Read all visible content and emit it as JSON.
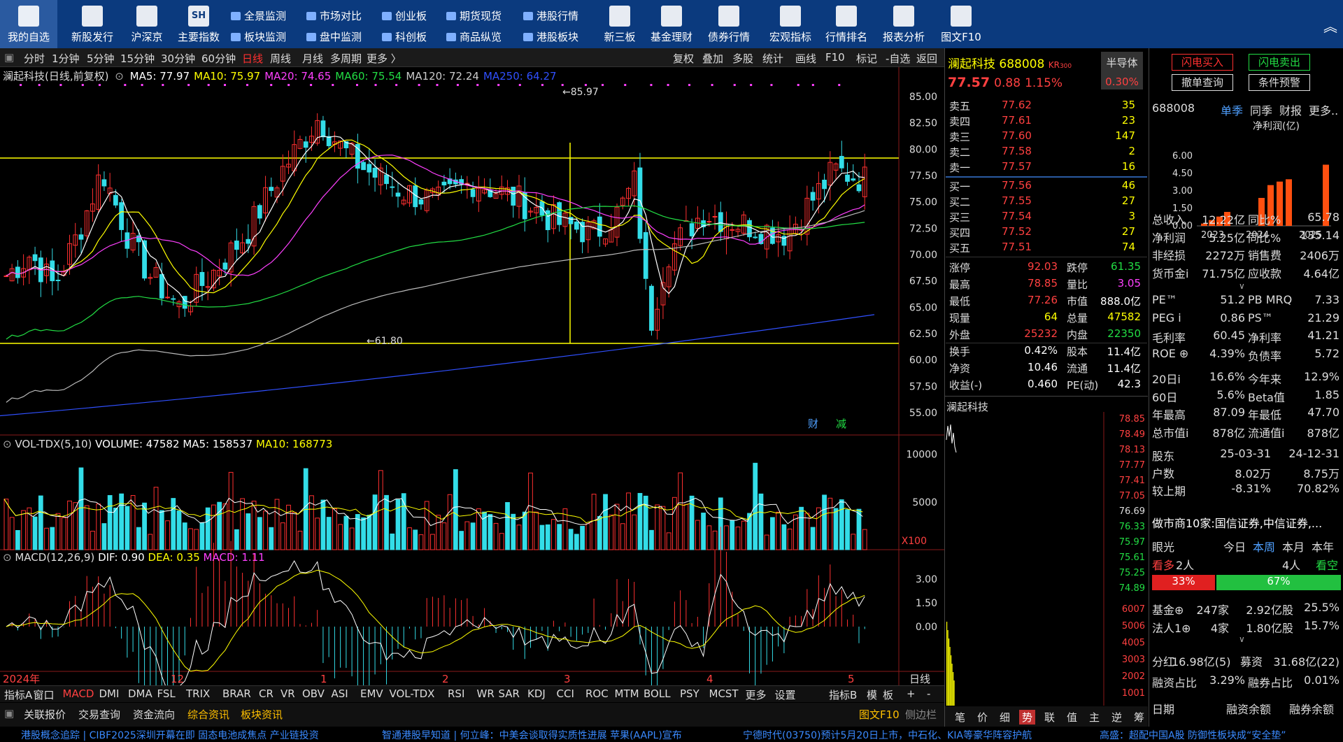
{
  "toolbar": {
    "big": [
      {
        "label": "我的自选",
        "icon": "star-list-icon"
      },
      {
        "label": "新股发行",
        "icon": "document-icon"
      },
      {
        "label": "沪深京",
        "icon": "chart-icon"
      },
      {
        "label": "主要指数",
        "icon": "sh-index-icon"
      },
      {
        "label": "新三板",
        "icon": "money-bag-icon"
      },
      {
        "label": "基金理财",
        "icon": "yen-icon"
      },
      {
        "label": "债券行情",
        "icon": "bond-list-icon"
      },
      {
        "label": "宏观指标",
        "icon": "globe-icon"
      },
      {
        "label": "行情排名",
        "icon": "camera-icon"
      },
      {
        "label": "报表分析",
        "icon": "report-icon"
      },
      {
        "label": "图文F10",
        "icon": "person-icon"
      }
    ],
    "small": [
      "全景监测",
      "市场对比",
      "创业板",
      "期货现货",
      "港股行情",
      "板块监测",
      "盘中监测",
      "科创板",
      "商品纵览",
      "港股板块"
    ],
    "sh_text": "SH"
  },
  "periods": [
    "分时",
    "1分钟",
    "5分钟",
    "15分钟",
    "30分钟",
    "60分钟",
    "日线",
    "周线",
    "月线",
    "多周期",
    "更多 〉"
  ],
  "tools": [
    "复权",
    "叠加",
    "多股",
    "统计",
    "画线",
    "F10",
    "标记",
    "-自选",
    "返回"
  ],
  "chart": {
    "title": "澜起科技(日线,前复权)",
    "ma": [
      {
        "t": "MA5: 77.97",
        "c": "#ffffff"
      },
      {
        "t": "MA10: 75.97",
        "c": "#ffff00"
      },
      {
        "t": "MA20: 74.65",
        "c": "#ff40ff"
      },
      {
        "t": "MA60: 75.54",
        "c": "#22dd44"
      },
      {
        "t": "MA120: 72.24",
        "c": "#cccccc"
      },
      {
        "t": "MA250: 64.27",
        "c": "#3050ff"
      }
    ],
    "high_label": "85.97",
    "low_label": "61.80",
    "y_ticks": [
      "85.00",
      "82.50",
      "80.00",
      "77.50",
      "75.00",
      "72.50",
      "70.00",
      "67.50",
      "65.00",
      "62.50",
      "60.00",
      "57.50",
      "55.00"
    ],
    "badge1": "财",
    "badge2": "减"
  },
  "volume": {
    "title": "VOL-TDX(5,10)",
    "v": "VOLUME: 47582",
    "ma5": "MA5: 158537",
    "ma10": "MA10: 168773",
    "ticks": [
      "10000",
      "5000"
    ],
    "unit": "X100"
  },
  "macd": {
    "title": "MACD(12,26,9)",
    "dif": "DIF: 0.90",
    "dea": "DEA: 0.35",
    "macd": "MACD: 1.11",
    "ticks": [
      "3.00",
      "1.50",
      "0.00"
    ]
  },
  "xaxis": [
    "2024年",
    "12",
    "1",
    "2",
    "3",
    "4",
    "5"
  ],
  "xaxis_right": "日线",
  "indicator_tabs": [
    "指标A",
    "窗口",
    "MACD",
    "DMI",
    "DMA",
    "FSL",
    "TRIX",
    "BRAR",
    "CR",
    "VR",
    "OBV",
    "ASI",
    "EMV",
    "VOL-TDX",
    "RSI",
    "WR",
    "SAR",
    "KDJ",
    "CCI",
    "ROC",
    "MTM",
    "BOLL",
    "PSY",
    "MCST",
    "更多",
    "设置"
  ],
  "indicator_right": [
    "指标B",
    "模",
    "板",
    "+",
    "-"
  ],
  "bottom_tabs": [
    "关联报价",
    "交易查询",
    "资金流向",
    "综合资讯",
    "板块资讯"
  ],
  "bottom_right": [
    "图文F10",
    "侧边栏"
  ],
  "quote": {
    "name": "澜起科技",
    "code": "688008",
    "kr": "KR",
    "kr_sub": "300",
    "price": "77.57",
    "chg": "0.88",
    "pct": "1.15%",
    "half": "半导体",
    "half_pct": "0.30%"
  },
  "sells": [
    [
      "卖五",
      "77.62",
      "35"
    ],
    [
      "卖四",
      "77.61",
      "23"
    ],
    [
      "卖三",
      "77.60",
      "147"
    ],
    [
      "卖二",
      "77.58",
      "2"
    ],
    [
      "卖一",
      "77.57",
      "16"
    ]
  ],
  "buys": [
    [
      "买一",
      "77.56",
      "46"
    ],
    [
      "买二",
      "77.55",
      "27"
    ],
    [
      "买三",
      "77.54",
      "3"
    ],
    [
      "买四",
      "77.52",
      "27"
    ],
    [
      "买五",
      "77.51",
      "74"
    ]
  ],
  "stats": [
    [
      "涨停",
      "92.03",
      "跌停",
      "61.35"
    ],
    [
      "最高",
      "78.85",
      "量比",
      "3.05"
    ],
    [
      "最低",
      "77.26",
      "市值",
      "888.0亿"
    ],
    [
      "现量",
      "64",
      "总量",
      "47582"
    ],
    [
      "外盘",
      "25232",
      "内盘",
      "22350"
    ],
    [
      "换手",
      "0.42%",
      "股本",
      "11.4亿"
    ],
    [
      "净资",
      "10.46",
      "流通",
      "11.4亿"
    ],
    [
      "收益(-)",
      "0.460",
      "PE(动)",
      "42.3"
    ]
  ],
  "intraday": {
    "title": "澜起科技",
    "prices": [
      "78.85",
      "78.49",
      "78.13",
      "77.77",
      "77.41",
      "77.05",
      "76.69",
      "76.33",
      "75.97",
      "75.61",
      "75.25",
      "74.89"
    ],
    "vols": [
      "6007",
      "5006",
      "4005",
      "3003",
      "2002",
      "1001"
    ],
    "tabs": [
      "笔",
      "价",
      "细",
      "势",
      "联",
      "值",
      "主",
      "逆",
      "筹"
    ]
  },
  "right": {
    "buttons": [
      "闪电买入",
      "闪电卖出",
      "撤单查询",
      "条件预警"
    ],
    "code": "688008",
    "tabs": [
      "单季",
      "同季",
      "财报",
      "更多.."
    ],
    "profit_label": "净利润(亿)",
    "yticks": [
      "6.00",
      "4.50",
      "3.00",
      "1.50",
      "0.00"
    ],
    "years": [
      "2023",
      "2024",
      "2025"
    ],
    "bars": [
      0.2,
      0.5,
      0.8,
      1.2,
      2.4,
      3.5,
      3.8,
      4.0,
      5.25
    ],
    "fin": [
      [
        "总收入",
        "12.22亿",
        "同比%",
        "65.78"
      ],
      [
        "净利润",
        "5.25亿",
        "同比%",
        "135.14"
      ],
      [
        "非经损",
        "2272万",
        "销售费",
        "2406万"
      ],
      [
        "货币金i",
        "71.75亿",
        "应收款",
        "4.64亿"
      ]
    ],
    "fin2": [
      [
        "PE™",
        "51.2",
        "PB MRQ",
        "7.33"
      ],
      [
        "PEG i",
        "0.86",
        "PS™",
        "21.29"
      ],
      [
        "毛利率",
        "60.45",
        "净利率",
        "41.21"
      ],
      [
        "ROE ⊕",
        "4.39%",
        "负债率",
        "5.72"
      ]
    ],
    "perf": [
      [
        "20日i",
        "16.6%",
        "今年来",
        "12.9%"
      ],
      [
        "60日",
        "5.6%",
        "Beta值",
        "1.85"
      ],
      [
        "年最高",
        "87.09",
        "年最低",
        "47.70"
      ],
      [
        "总市值i",
        "878亿",
        "流通值i",
        "878亿"
      ]
    ],
    "holders": [
      [
        "股东",
        "25-03-31",
        "24-12-31"
      ],
      [
        "户数",
        "8.02万",
        "8.75万"
      ],
      [
        "较上期",
        "-8.31%",
        "70.82%"
      ]
    ],
    "mm": "做市商10家:国信证券,中信证券,...",
    "eye": "眼光",
    "eye_tabs": [
      "今日",
      "本周",
      "本月",
      "本年"
    ],
    "bull": "看多",
    "bull_n": "2人",
    "bear_n": "4人",
    "bear": "看空",
    "bull_pct": "33%",
    "bear_pct": "67%",
    "fund": [
      [
        "基金⊕",
        "247家",
        "2.92亿股",
        "25.5%"
      ],
      [
        "法人1⊕",
        "4家",
        "1.80亿股",
        "15.7%"
      ]
    ],
    "div": "分红",
    "div_v": "16.98亿(5)",
    "raise": "募资",
    "raise_v": "31.68亿(22)",
    "margin": [
      [
        "融资占比",
        "3.29%",
        "融券占比",
        "0.01%"
      ]
    ],
    "margin_hdr": [
      "日期",
      "融资余额",
      "融券余额"
    ]
  },
  "ticker": [
    "港股概念追踪 | CIBF2025深圳开幕在即 固态电池成焦点 产业链投资",
    "智通港股早知道 | 何立峰：中美会谈取得实质性进展 苹果(AAPL)宣布",
    "宁德时代(03750)预计5月20日上市，中石化、KIA等豪华阵容护航",
    "高盛：超配中国A股 防御性板块成“安全垫”"
  ]
}
